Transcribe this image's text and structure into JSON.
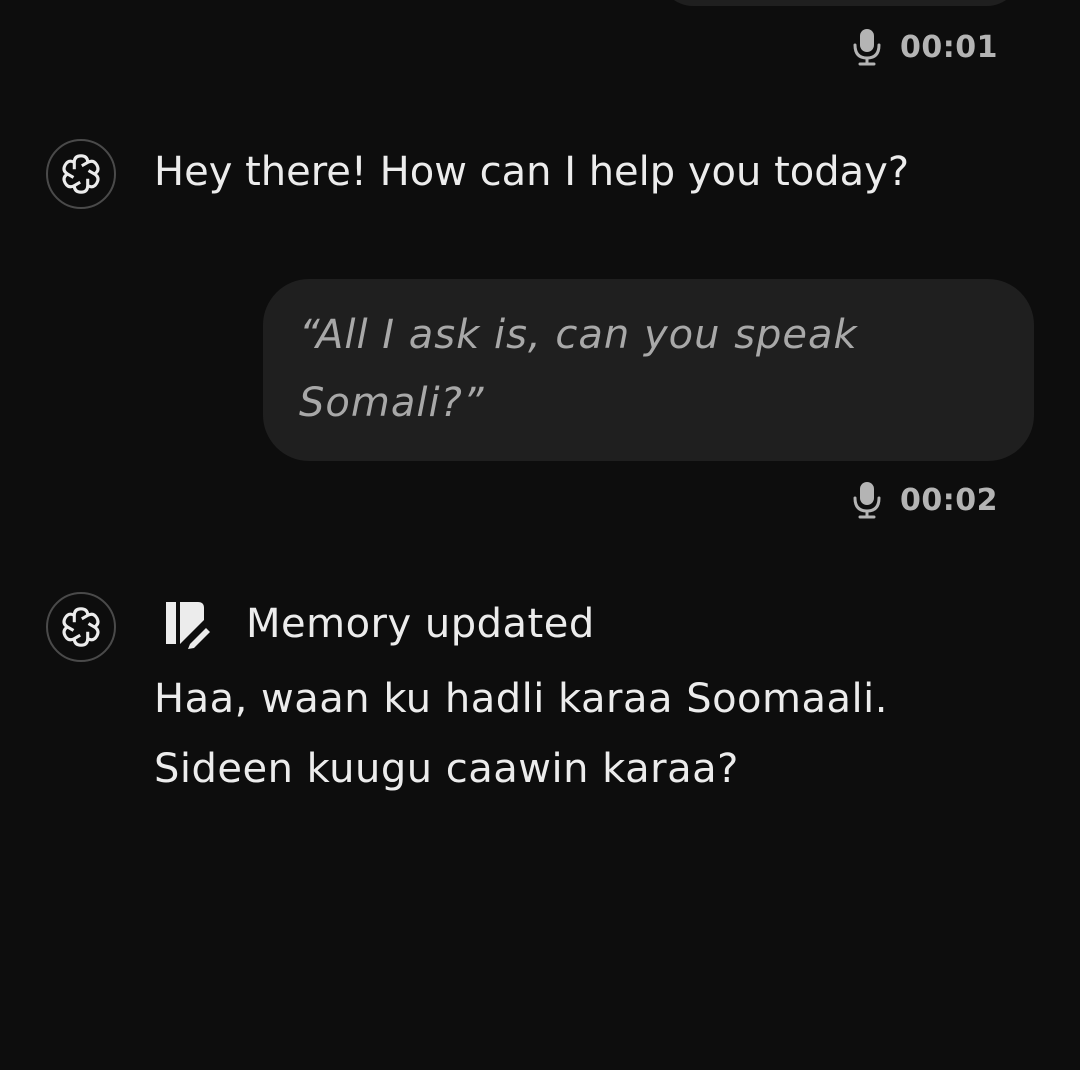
{
  "conversation": {
    "voice_durations": {
      "first": "00:01",
      "second": "00:02"
    },
    "assistant_greeting": "Hey there! How can I help you today?",
    "user_transcript": "“All I ask is, can you speak Somali?”",
    "memory_status": "Memory updated",
    "assistant_reply_lines": [
      "Haa, waan ku hadli karaa Soomaali.",
      "Sideen kuugu caawin karaa?"
    ]
  },
  "icons": {
    "avatar": "openai-logo-icon",
    "voice": "microphone-icon",
    "memory": "memory-edit-icon"
  },
  "colors": {
    "background": "#0d0d0d",
    "bubble": "#1f1f1f",
    "text": "#ececec",
    "muted": "#b4b4b4"
  }
}
